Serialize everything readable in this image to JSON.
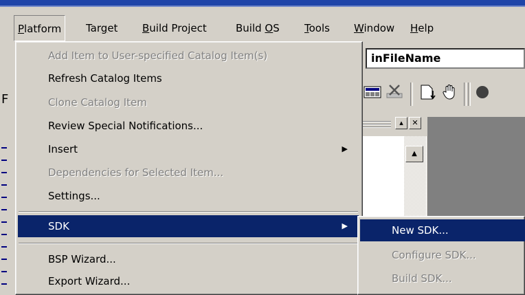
{
  "menubar": {
    "items": [
      {
        "label": "Platform",
        "mnemonic_index": 0
      },
      {
        "label": "Target",
        "mnemonic_index": 3
      },
      {
        "label": "Build Project",
        "mnemonic_index": 0
      },
      {
        "label": "Build OS",
        "mnemonic_index": 6
      },
      {
        "label": "Tools",
        "mnemonic_index": 0
      },
      {
        "label": "Window",
        "mnemonic_index": 0
      },
      {
        "label": "Help",
        "mnemonic_index": 0
      }
    ]
  },
  "platform_menu": {
    "items": [
      {
        "label": "Add Item to User-specified Catalog Item(s)",
        "enabled": false
      },
      {
        "label": "Refresh Catalog Items",
        "enabled": true
      },
      {
        "label": "Clone Catalog Item",
        "enabled": false
      },
      {
        "label": "Review Special Notifications...",
        "enabled": true
      },
      {
        "label": "Insert",
        "enabled": true,
        "submenu": true
      },
      {
        "label": "Dependencies for Selected Item...",
        "enabled": false
      },
      {
        "label": "Settings...",
        "enabled": true
      },
      {
        "label": "SDK",
        "enabled": true,
        "submenu": true,
        "selected": true
      },
      {
        "label": "BSP Wizard...",
        "enabled": true
      },
      {
        "label": "Export Wizard...",
        "enabled": true
      }
    ]
  },
  "sdk_submenu": {
    "items": [
      {
        "label": "New SDK...",
        "enabled": true,
        "selected": true
      },
      {
        "label": "Configure SDK...",
        "enabled": false
      },
      {
        "label": "Build SDK...",
        "enabled": false
      }
    ]
  },
  "background": {
    "filename_field": "inFileName",
    "left_pane_letter": "F"
  },
  "icons": {
    "submenu_arrow": "triangle-right-icon",
    "toolbar": [
      "catalog-icon",
      "delete-icon",
      "properties-icon",
      "hand-icon"
    ]
  },
  "colors": {
    "menu_bg": "#d4d0c8",
    "highlight": "#0a246a",
    "disabled_text": "#808080",
    "title_strip": "#1f44a8"
  }
}
